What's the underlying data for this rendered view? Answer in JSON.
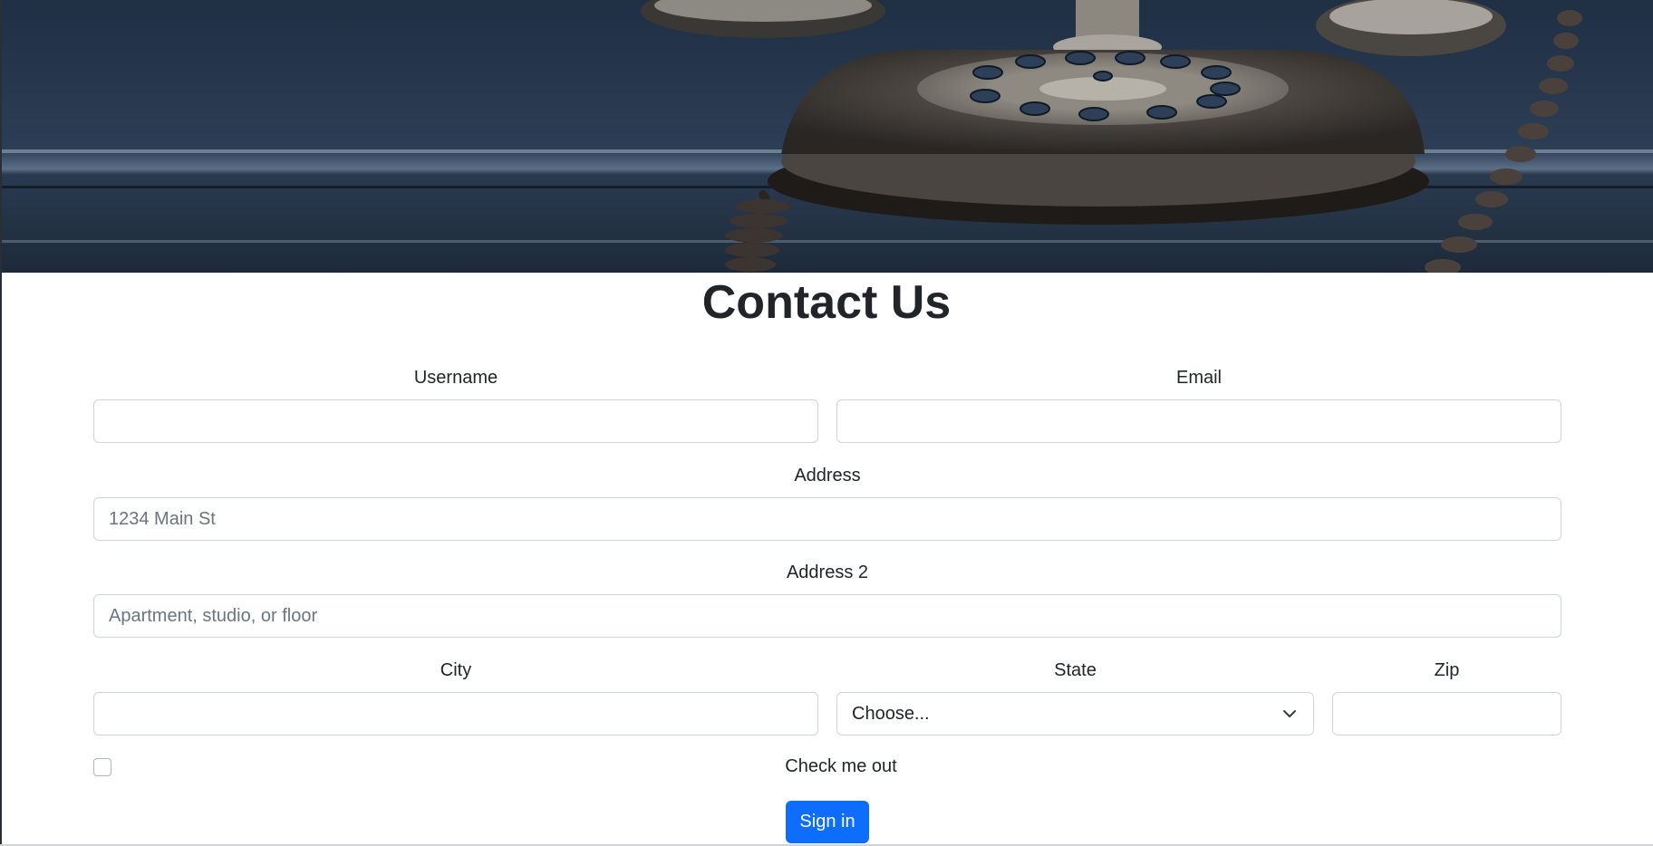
{
  "page": {
    "title": "Contact Us"
  },
  "hero": {
    "image_name": "vintage-rotary-telephone-banner"
  },
  "form": {
    "username": {
      "label": "Username",
      "value": "",
      "placeholder": ""
    },
    "email": {
      "label": "Email",
      "value": "",
      "placeholder": ""
    },
    "address": {
      "label": "Address",
      "value": "",
      "placeholder": "1234 Main St"
    },
    "address2": {
      "label": "Address 2",
      "value": "",
      "placeholder": "Apartment, studio, or floor"
    },
    "city": {
      "label": "City",
      "value": "",
      "placeholder": ""
    },
    "state": {
      "label": "State",
      "selected": "Choose..."
    },
    "zip": {
      "label": "Zip",
      "value": "",
      "placeholder": ""
    },
    "checkbox": {
      "label": "Check me out",
      "checked": false
    },
    "submit_label": "Sign in"
  },
  "colors": {
    "primary": "#0d6efd",
    "text": "#212529",
    "border": "#ced4da",
    "placeholder": "#6c757d"
  },
  "icons": {
    "select_arrow": "chevron-down-icon"
  }
}
